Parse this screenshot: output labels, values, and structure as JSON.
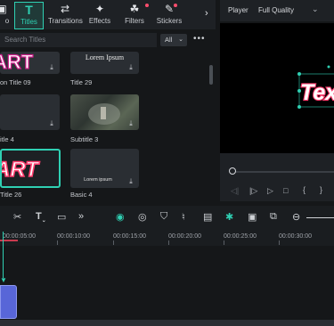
{
  "tabs": [
    {
      "label": "o",
      "icon": "media-icon"
    },
    {
      "label": "Titles",
      "icon": "titles-icon",
      "active": true
    },
    {
      "label": "Transitions",
      "icon": "transitions-icon"
    },
    {
      "label": "Effects",
      "icon": "effects-icon"
    },
    {
      "label": "Filters",
      "icon": "filters-icon",
      "badge": true
    },
    {
      "label": "Stickers",
      "icon": "stickers-icon",
      "badge": true
    }
  ],
  "search": {
    "placeholder": "Search Titles",
    "filter": "All"
  },
  "titles": [
    {
      "label": "on Title 09",
      "preview": "ART"
    },
    {
      "label": "Title 29",
      "preview": "Lorem Ipsum"
    },
    {
      "label": "itle 4",
      "preview": ""
    },
    {
      "label": "Subtitle 3",
      "preview": ""
    },
    {
      "label": "Title 26",
      "preview": "ART"
    },
    {
      "label": "Basic 4",
      "preview": "Lorem ipsum"
    }
  ],
  "player": {
    "label": "Player",
    "quality": "Full Quality",
    "preview_text": "Tex"
  },
  "timeline": {
    "ruler": [
      "00:00:05:00",
      "00:00:10:00",
      "00:00:15:00",
      "00:00:20:00",
      "00:00:25:00",
      "00:00:30:00"
    ]
  },
  "colors": {
    "accent": "#2fd0b3",
    "clip": "#5866d8",
    "title_pink": "#ff3d6e"
  }
}
